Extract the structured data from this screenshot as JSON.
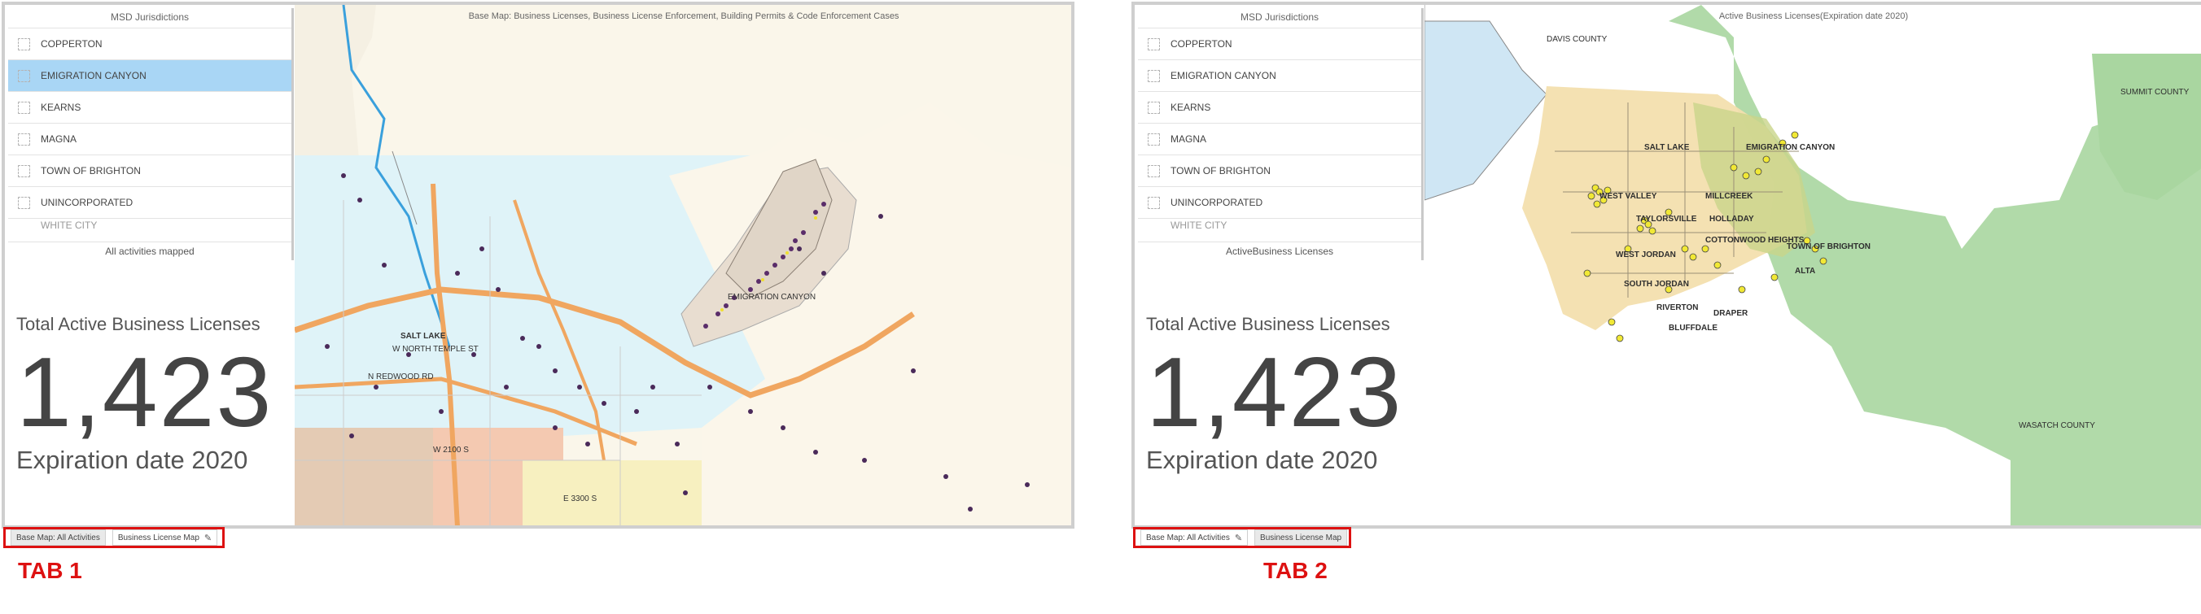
{
  "dashboard1": {
    "list": {
      "title": "MSD Jurisdictions",
      "items": [
        {
          "label": "COPPERTON"
        },
        {
          "label": "EMIGRATION CANYON"
        },
        {
          "label": "KEARNS"
        },
        {
          "label": "MAGNA"
        },
        {
          "label": "TOWN OF BRIGHTON"
        },
        {
          "label": "UNINCORPORATED"
        },
        {
          "label": "WHITE CITY"
        }
      ],
      "footer": "All activities mapped"
    },
    "indicator": {
      "title": "Total Active Business Licenses",
      "value": "1,423",
      "subtitle": "Expiration date 2020"
    },
    "map": {
      "title": "Base Map: Business Licenses, Business License Enforcement, Building Permits & Code Enforcement Cases",
      "labels": [
        "SALT LAKE",
        "W NORTH TEMPLE ST",
        "EMIGRATION CANYON",
        "N REDWOOD RD",
        "W 2100 S",
        "E 3300 S"
      ]
    },
    "tabs": [
      {
        "label": "Base Map: All Activities",
        "active": false
      },
      {
        "label": "Business License Map",
        "active": true
      }
    ],
    "tab_caption": "TAB 1"
  },
  "dashboard2": {
    "list": {
      "title": "MSD Jurisdictions",
      "items": [
        {
          "label": "COPPERTON"
        },
        {
          "label": "EMIGRATION CANYON"
        },
        {
          "label": "KEARNS"
        },
        {
          "label": "MAGNA"
        },
        {
          "label": "TOWN OF BRIGHTON"
        },
        {
          "label": "UNINCORPORATED"
        },
        {
          "label": "WHITE CITY"
        }
      ],
      "footer": "ActiveBusiness Licenses"
    },
    "indicator": {
      "title": "Total Active Business Licenses",
      "value": "1,423",
      "subtitle": "Expiration date 2020"
    },
    "map": {
      "title": "Active Business Licenses(Expiration date 2020)",
      "labels": [
        "DAVIS COUNTY",
        "SUMMIT COUNTY",
        "WASATCH COUNTY",
        "SALT LAKE",
        "EMIGRATION CANYON",
        "WEST VALLEY",
        "MILLCREEK",
        "TAYLORSVILLE",
        "HOLLADAY",
        "COTTONWOOD HEIGHTS",
        "WEST JORDAN",
        "TOWN OF BRIGHTON",
        "SOUTH JORDAN",
        "ALTA",
        "RIVERTON",
        "DRAPER",
        "BLUFFDALE"
      ]
    },
    "tabs": [
      {
        "label": "Base Map: All Activities",
        "active": true
      },
      {
        "label": "Business License Map",
        "active": false
      }
    ],
    "tab_caption": "TAB 2"
  }
}
